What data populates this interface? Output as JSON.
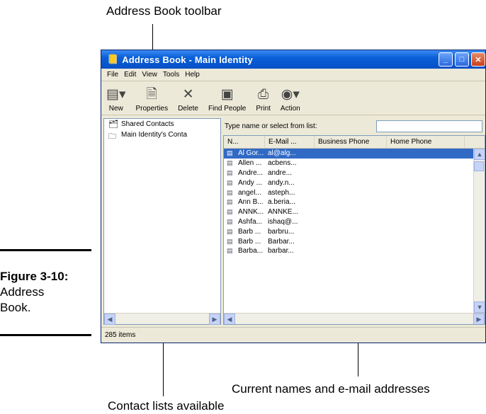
{
  "callouts": {
    "toolbar": "Address Book toolbar",
    "current": "Current names and e-mail addresses",
    "contacts": "Contact lists available"
  },
  "figure": {
    "label": "Figure 3-10:",
    "caption_line1": "Address",
    "caption_line2": "Book."
  },
  "window": {
    "title": "Address Book - Main Identity"
  },
  "menu": [
    "File",
    "Edit",
    "View",
    "Tools",
    "Help"
  ],
  "toolbar": [
    {
      "label": "New",
      "icon": "new-card-icon"
    },
    {
      "label": "Properties",
      "icon": "properties-icon"
    },
    {
      "label": "Delete",
      "icon": "delete-x-icon"
    },
    {
      "label": "Find People",
      "icon": "find-people-icon"
    },
    {
      "label": "Print",
      "icon": "printer-icon"
    },
    {
      "label": "Action",
      "icon": "action-icon"
    }
  ],
  "tree": [
    "Shared Contacts",
    "Main Identity's Conta"
  ],
  "search": {
    "label": "Type name or select from list:",
    "value": ""
  },
  "columns": [
    "N...",
    "E-Mail ...",
    "Business Phone",
    "Home Phone"
  ],
  "rows": [
    {
      "name": "Al Gor...",
      "email": "al@alg...",
      "selected": true
    },
    {
      "name": "Allen ...",
      "email": "acbens..."
    },
    {
      "name": "Andre...",
      "email": "andre..."
    },
    {
      "name": "Andy ...",
      "email": "andy.n..."
    },
    {
      "name": "angel...",
      "email": "asteph..."
    },
    {
      "name": "Ann B...",
      "email": "a.beria..."
    },
    {
      "name": "ANNK...",
      "email": "ANNKE..."
    },
    {
      "name": "Ashfa...",
      "email": "ishaq@..."
    },
    {
      "name": "Barb ...",
      "email": "barbru..."
    },
    {
      "name": "Barb ...",
      "email": "Barbar..."
    },
    {
      "name": "Barba...",
      "email": "barbar..."
    }
  ],
  "status": {
    "items": "285 items"
  }
}
